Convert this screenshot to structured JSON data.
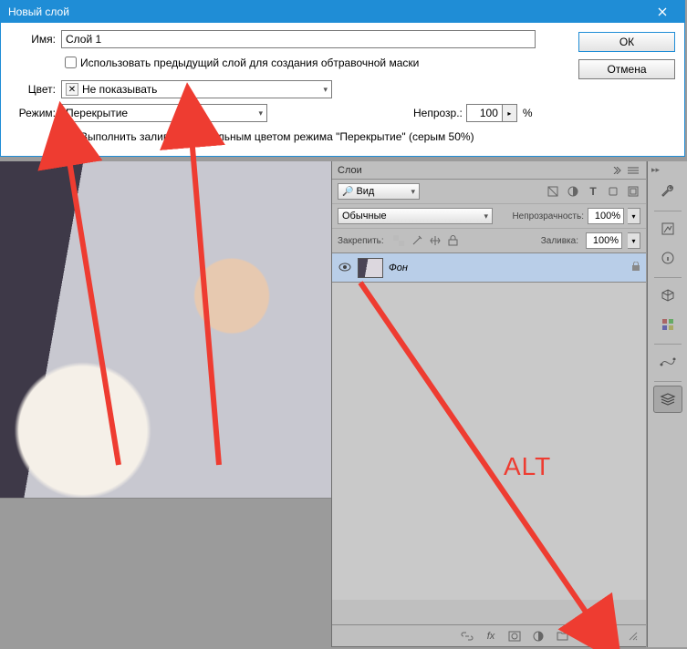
{
  "dialog": {
    "title": "Новый слой",
    "name_label": "Имя:",
    "name_value": "Слой 1",
    "use_prev_mask": "Использовать предыдущий слой для создания обтравочной маски",
    "color_label": "Цвет:",
    "color_value": "Не показывать",
    "mode_label": "Режим:",
    "mode_value": "Перекрытие",
    "opacity_label": "Непрозр.:",
    "opacity_value": "100",
    "opacity_unit": "%",
    "fill_neutral": "Выполнить заливку нейтральным цветом режима \"Перекрытие\"  (серым 50%)",
    "ok": "ОК",
    "cancel": "Отмена"
  },
  "panel": {
    "title": "Слои",
    "kind_label": "Вид",
    "blend_value": "Обычные",
    "opacity_label": "Непрозрачность:",
    "opacity_value": "100%",
    "lock_label": "Закрепить:",
    "fill_label": "Заливка:",
    "fill_value": "100%",
    "layers": [
      {
        "name": "Фон"
      }
    ]
  },
  "annotation": {
    "alt": "ALT"
  }
}
